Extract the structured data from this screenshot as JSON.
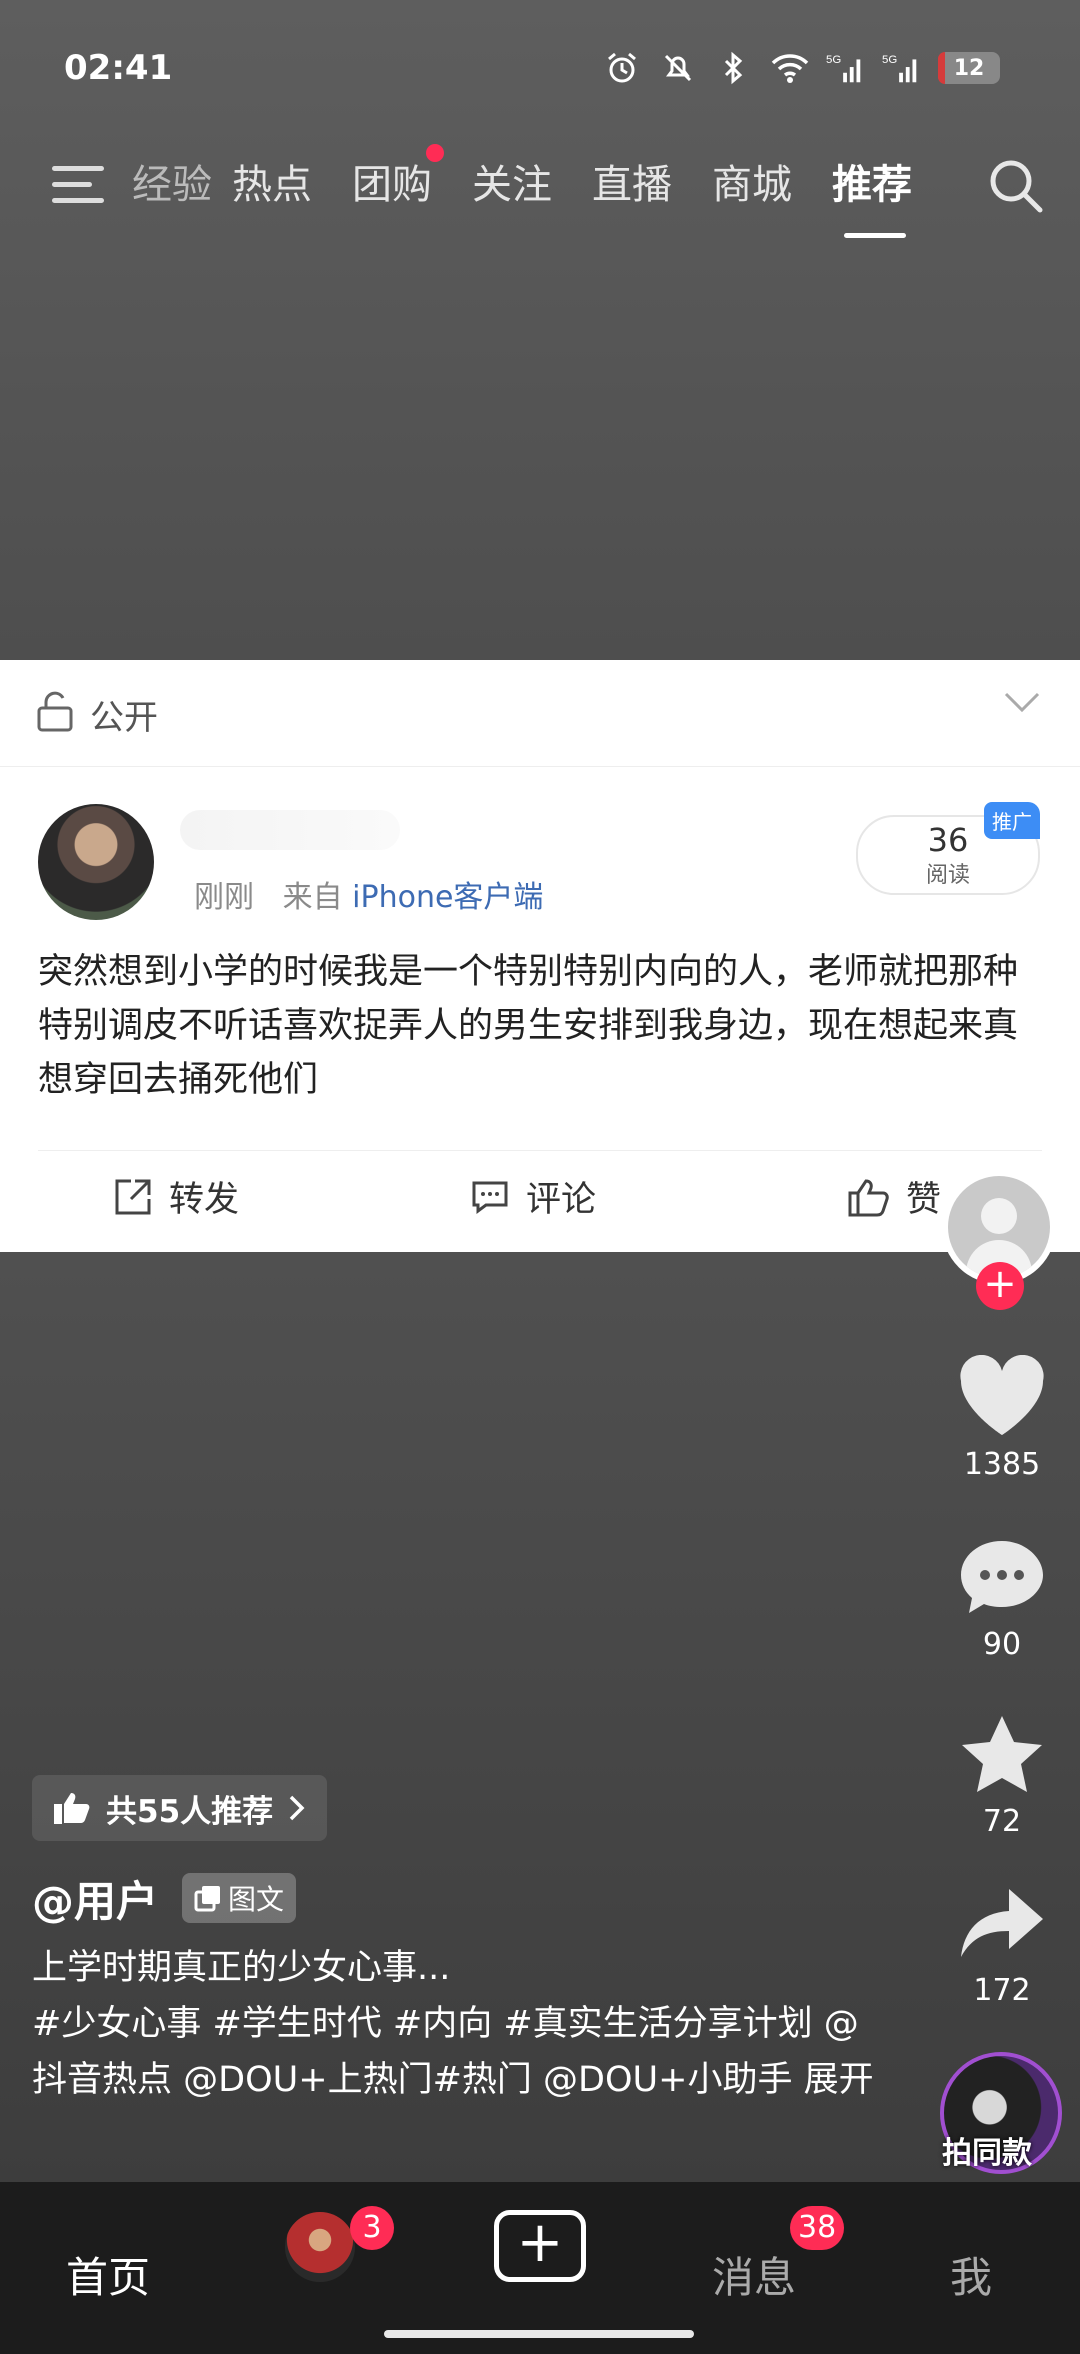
{
  "status": {
    "time": "02:41",
    "battery": "12",
    "battery_level": 0.12,
    "sim1": "5G",
    "sim2": "5G"
  },
  "nav": {
    "tabs": [
      "经验",
      "热点",
      "团购",
      "关注",
      "直播",
      "商城",
      "推荐"
    ],
    "active_tab": "推荐",
    "tab_with_dot": "团购"
  },
  "post": {
    "visibility": "公开",
    "time": "刚刚",
    "from_label": "来自",
    "source": "iPhone客户端",
    "reads_count": "36",
    "reads_label": "阅读",
    "promo_badge": "推广",
    "text": "突然想到小学的时候我是一个特别特别内向的人，老师就把那种特别调皮不听话喜欢捉弄人的男生安排到我身边，现在想起来真想穿回去捅死他们",
    "forward": "转发",
    "comment": "评论",
    "like": "赞"
  },
  "side": {
    "likes": "1385",
    "comments": "90",
    "favorites": "72",
    "shares": "172",
    "music_label": "拍同款"
  },
  "video_info": {
    "recommend": "共55人推荐",
    "author": "@用户",
    "type_tag": "图文",
    "description": "上学时期真正的少女心事...",
    "hashtags": "#少女心事 #学生时代 #内向 #真实生活分享计划 @抖音热点 @DOU+上热门#热门 @DOU+小助手",
    "expand": "展开"
  },
  "bottom": {
    "home": "首页",
    "friends_badge": "3",
    "messages": "消息",
    "messages_badge": "38",
    "me": "我"
  },
  "colors": {
    "accent": "#ff2c55",
    "link": "#3d6bb3",
    "promo": "#3d8df5"
  }
}
